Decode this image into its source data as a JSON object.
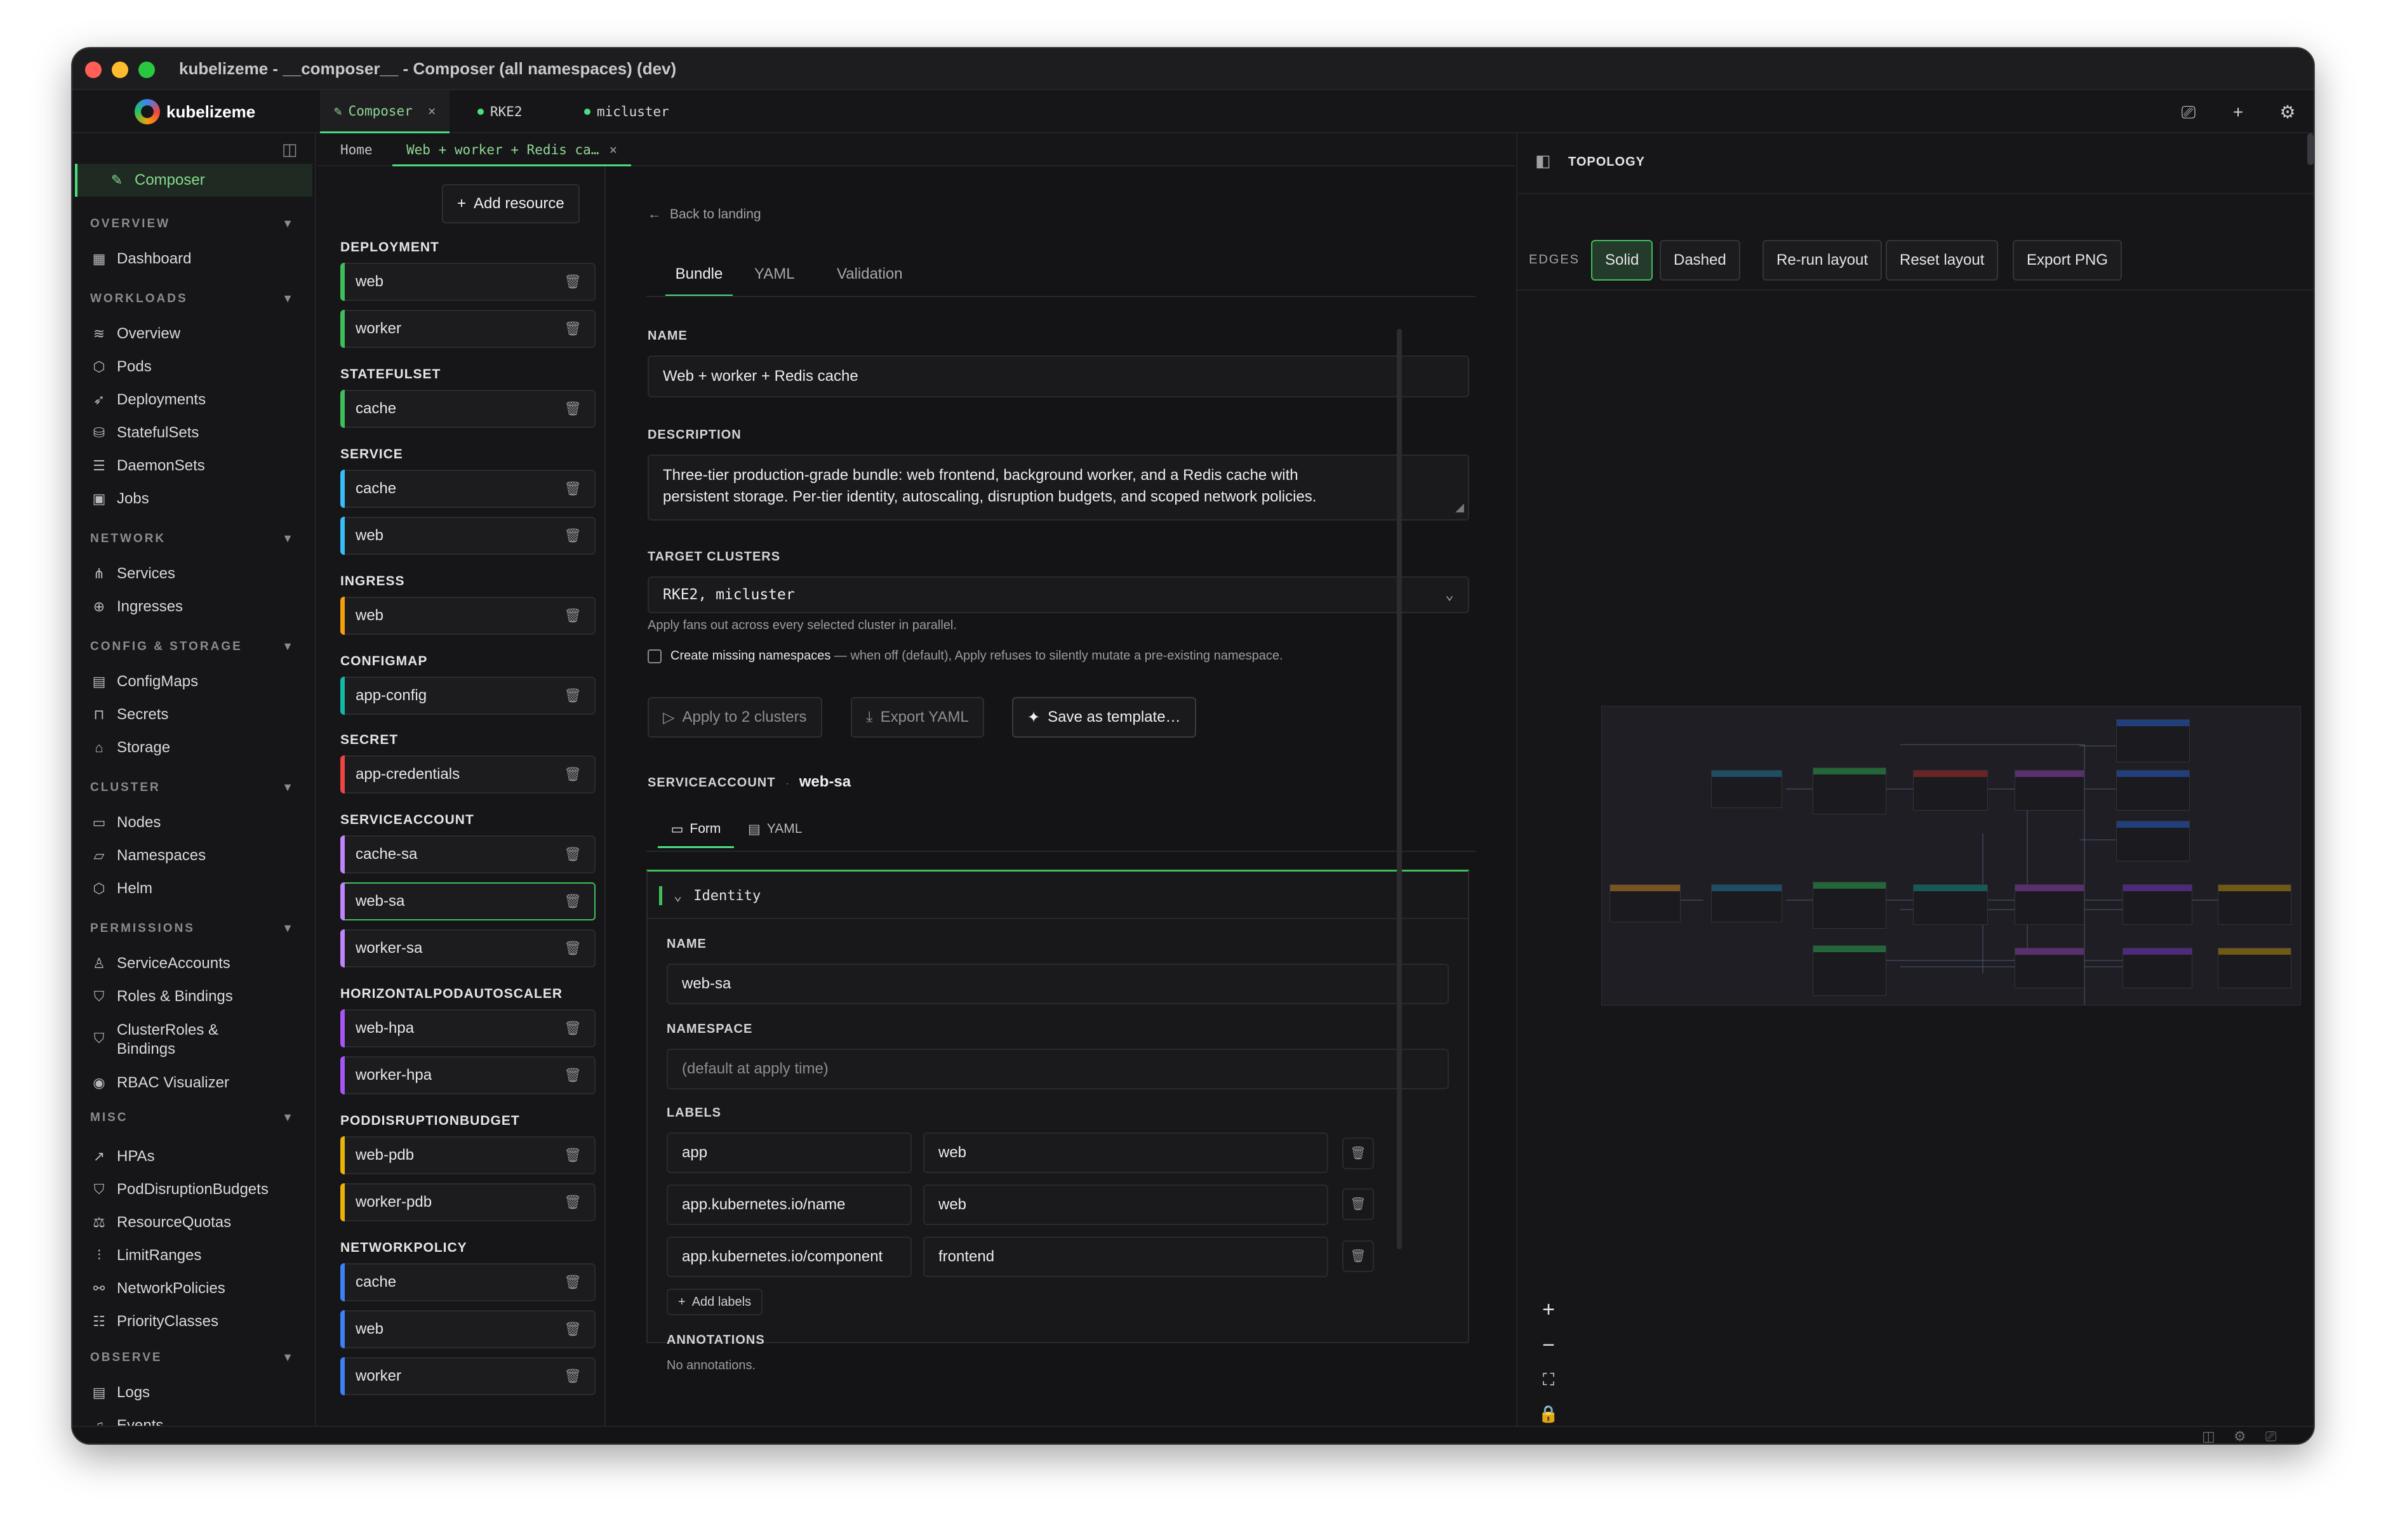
{
  "window": {
    "title": "kubelizeme - __composer__ - Composer (all namespaces) (dev)"
  },
  "app": {
    "name": "kubelizeme"
  },
  "tabs": [
    {
      "label": "Composer",
      "close": "×"
    },
    {
      "label": "RKE2"
    },
    {
      "label": "micluster"
    }
  ],
  "breadcrumb": {
    "home": "Home",
    "current": "Web + worker + Redis ca…",
    "close": "×"
  },
  "sidebar": {
    "composer": "Composer",
    "sections": {
      "overview": "OVERVIEW",
      "workloads": "WORKLOADS",
      "network": "NETWORK",
      "config": "CONFIG & STORAGE",
      "cluster": "CLUSTER",
      "permissions": "PERMISSIONS",
      "misc": "MISC",
      "observe": "OBSERVE"
    },
    "items": {
      "dashboard": "Dashboard",
      "overview": "Overview",
      "pods": "Pods",
      "deployments": "Deployments",
      "statefulsets": "StatefulSets",
      "daemonsets": "DaemonSets",
      "jobs": "Jobs",
      "services": "Services",
      "ingresses": "Ingresses",
      "configmaps": "ConfigMaps",
      "secrets": "Secrets",
      "storage": "Storage",
      "nodes": "Nodes",
      "namespaces": "Namespaces",
      "helm": "Helm",
      "serviceaccounts": "ServiceAccounts",
      "roles": "Roles & Bindings",
      "clusterroles1": "ClusterRoles &",
      "clusterroles2": "Bindings",
      "rbac": "RBAC Visualizer",
      "hpas": "HPAs",
      "pdbs": "PodDisruptionBudgets",
      "quotas": "ResourceQuotas",
      "limits": "LimitRanges",
      "netpol": "NetworkPolicies",
      "prio": "PriorityClasses",
      "logs": "Logs",
      "events": "Events"
    }
  },
  "resources": {
    "add_label": "Add resource",
    "groups": {
      "deployment": "DEPLOYMENT",
      "statefulset": "STATEFULSET",
      "service": "SERVICE",
      "ingress": "INGRESS",
      "configmap": "CONFIGMAP",
      "secret": "SECRET",
      "serviceaccount": "SERVICEACCOUNT",
      "hpa": "HORIZONTALPODAUTOSCALER",
      "pdb": "PODDISRUPTIONBUDGET",
      "netpol": "NETWORKPOLICY"
    },
    "items": {
      "dep_web": "web",
      "dep_worker": "worker",
      "sts_cache": "cache",
      "svc_cache": "cache",
      "svc_web": "web",
      "ing_web": "web",
      "cm_app": "app-config",
      "sec_app": "app-credentials",
      "sa_cache": "cache-sa",
      "sa_web": "web-sa",
      "sa_worker": "worker-sa",
      "hpa_web": "web-hpa",
      "hpa_worker": "worker-hpa",
      "pdb_web": "web-pdb",
      "pdb_worker": "worker-pdb",
      "np_cache": "cache",
      "np_web": "web",
      "np_worker": "worker"
    }
  },
  "form": {
    "back": "Back to landing",
    "tabs": {
      "bundle": "Bundle",
      "yaml": "YAML",
      "validation": "Validation"
    },
    "name_label": "NAME",
    "name_value": "Web + worker + Redis cache",
    "desc_label": "DESCRIPTION",
    "desc_line1": "Three-tier production-grade bundle: web frontend, background worker, and a Redis cache with",
    "desc_line2": "persistent storage. Per-tier identity, autoscaling, disruption budgets, and scoped network policies.",
    "clusters_label": "TARGET CLUSTERS",
    "clusters_value": "RKE2, micluster",
    "clusters_hint": "Apply fans out across every selected cluster in parallel.",
    "create_ns_bold": "Create missing namespaces",
    "create_ns_rest": " — when off (default), Apply refuses to silently mutate a pre-existing namespace.",
    "apply_btn": "Apply to 2 clusters",
    "export_btn": "Export YAML",
    "save_btn": "Save as template…",
    "sa_kind": "SERVICEACCOUNT",
    "sa_sep": "·",
    "sa_name": "web-sa",
    "sa_tabs": {
      "form": "Form",
      "yaml": "YAML"
    },
    "identity": "Identity",
    "id_name_label": "NAME",
    "id_name_value": "web-sa",
    "ns_label": "NAMESPACE",
    "ns_placeholder": "(default at apply time)",
    "labels_label": "LABELS",
    "labels": [
      {
        "key": "app",
        "value": "web"
      },
      {
        "key": "app.kubernetes.io/name",
        "value": "web"
      },
      {
        "key": "app.kubernetes.io/component",
        "value": "frontend"
      }
    ],
    "add_labels": "Add labels",
    "annotations_label": "ANNOTATIONS",
    "annotations_empty": "No annotations."
  },
  "topology": {
    "title": "TOPOLOGY",
    "edges_label": "EDGES",
    "solid": "Solid",
    "dashed": "Dashed",
    "rerun": "Re-run layout",
    "reset": "Reset layout",
    "export": "Export PNG"
  },
  "colors": {
    "accent": "#4ade80",
    "deployment": "#3fbf5a",
    "statefulset": "#3fbf5a",
    "service": "#38bdf8",
    "ingress": "#f59e0b",
    "configmap": "#14b8a6",
    "secret": "#ef4444",
    "serviceaccount": "#c084fc",
    "hpa": "#a855f7",
    "pdb": "#eab308",
    "networkpolicy": "#3b82f6"
  }
}
